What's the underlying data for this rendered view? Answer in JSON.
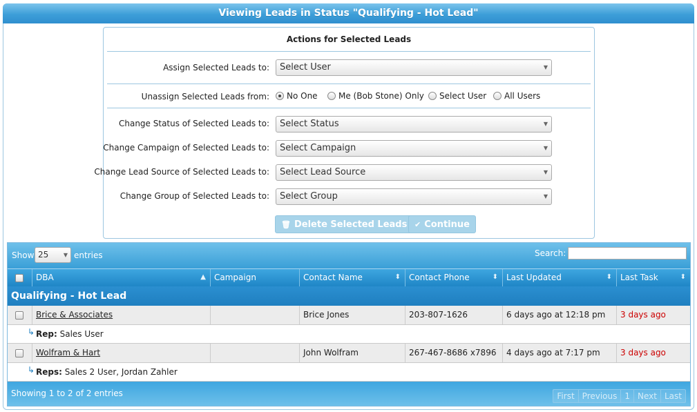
{
  "title": "Viewing Leads in Status \"Qualifying - Hot Lead\"",
  "actions": {
    "heading": "Actions for Selected Leads",
    "assign": {
      "label": "Assign Selected Leads to:",
      "value": "Select User"
    },
    "unassign": {
      "label": "Unassign Selected Leads from:",
      "options": [
        "No One",
        "Me (Bob Stone) Only",
        "Select User",
        "All Users"
      ],
      "selected": "No One"
    },
    "status": {
      "label": "Change Status of Selected Leads to:",
      "value": "Select Status"
    },
    "campaign": {
      "label": "Change Campaign of Selected Leads to:",
      "value": "Select Campaign"
    },
    "lead_source": {
      "label": "Change Lead Source of Selected Leads to:",
      "value": "Select Lead Source"
    },
    "group": {
      "label": "Change Group of Selected Leads to:",
      "value": "Select Group"
    },
    "delete_button": "Delete Selected Leads",
    "continue_button": "Continue"
  },
  "table": {
    "show_label": "Show",
    "page_length": "25",
    "entries_label": "entries",
    "search_label": "Search:",
    "search_value": "",
    "columns": [
      "DBA",
      "Campaign",
      "Contact Name",
      "Contact Phone",
      "Last Updated",
      "Last Task"
    ],
    "group_name": "Qualifying - Hot Lead",
    "rows": [
      {
        "dba": "Brice & Associates",
        "campaign": "",
        "contact_name": "Brice Jones",
        "contact_phone": "203-807-1626",
        "last_updated": "6 days ago at 12:18 pm",
        "last_task": "3 days ago",
        "rep_label": "Rep:",
        "reps": "Sales User"
      },
      {
        "dba": "Wolfram & Hart",
        "campaign": "",
        "contact_name": "John Wolfram",
        "contact_phone": "267-467-8686 x7896",
        "last_updated": "4 days ago at 7:17 pm",
        "last_task": "3 days ago",
        "rep_label": "Reps:",
        "reps": "Sales 2 User, Jordan Zahler"
      }
    ],
    "info": "Showing 1 to 2 of 2 entries",
    "pager": [
      "First",
      "Previous",
      "1",
      "Next",
      "Last"
    ]
  },
  "colors": {
    "header_blue": "#3d9ed8",
    "overdue_red": "#cc0000",
    "button_disabled": "#a8d4ea"
  }
}
